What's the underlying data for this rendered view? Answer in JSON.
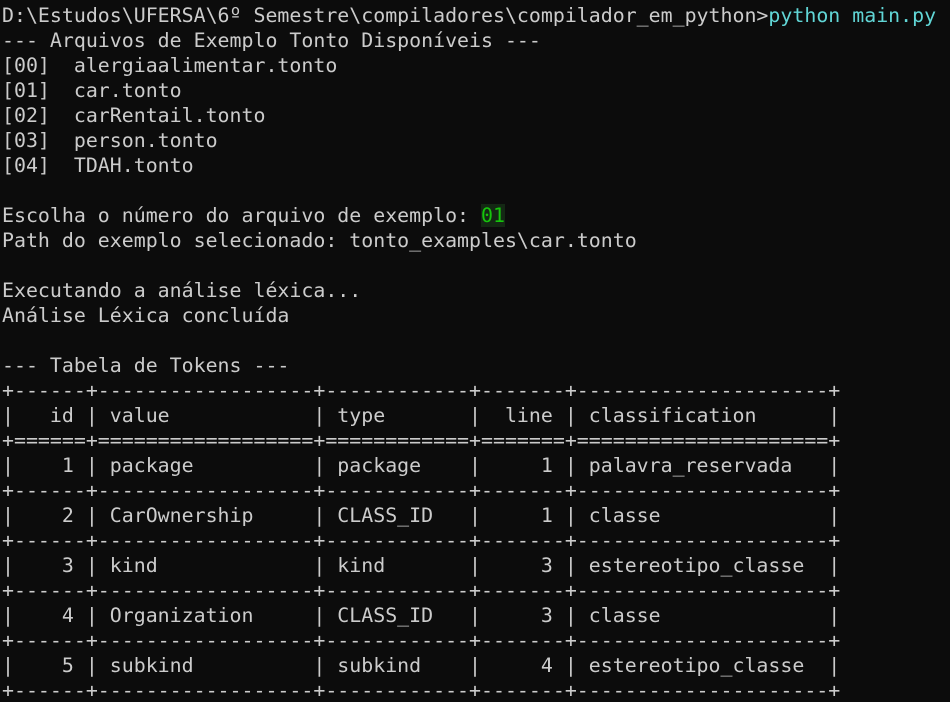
{
  "terminal": {
    "prompt": "D:\\Estudos\\UFERSA\\6º Semestre\\compiladores\\compilador_em_python>",
    "command": "python main.py",
    "examples_header": "--- Arquivos de Exemplo Tonto Disponíveis ---",
    "examples": [
      "[00]  alergiaalimentar.tonto",
      "[01]  car.tonto",
      "[02]  carRentail.tonto",
      "[03]  person.tonto",
      "[04]  TDAH.tonto"
    ],
    "choose_prompt": "Escolha o número do arquivo de exemplo: ",
    "choose_answer": "01",
    "path_line": "Path do exemplo selecionado: tonto_examples\\car.tonto",
    "lexical_running": "Executando a análise léxica...",
    "lexical_done": "Análise Léxica concluída",
    "tokens_header": "--- Tabela de Tokens ---",
    "table": {
      "border": "+------+------------------+------------+-------+---------------------+",
      "header_row": "|   id | value            | type       |  line | classification      |",
      "header_border": "+======+==================+============+=======+=====================+",
      "rows": [
        "|    1 | package          | package    |     1 | palavra_reservada   |",
        "|    2 | CarOwnership     | CLASS_ID   |     1 | classe              |",
        "|    3 | kind             | kind       |     3 | estereotipo_classe  |",
        "|    4 | Organization     | CLASS_ID   |     3 | classe              |",
        "|    5 | subkind          | subkind    |     4 | estereotipo_classe  |"
      ]
    }
  },
  "colors": {
    "background": "#0c0c0c",
    "text": "#cccccc",
    "command": "#61d6d6",
    "input_answer": "#16c60c"
  }
}
